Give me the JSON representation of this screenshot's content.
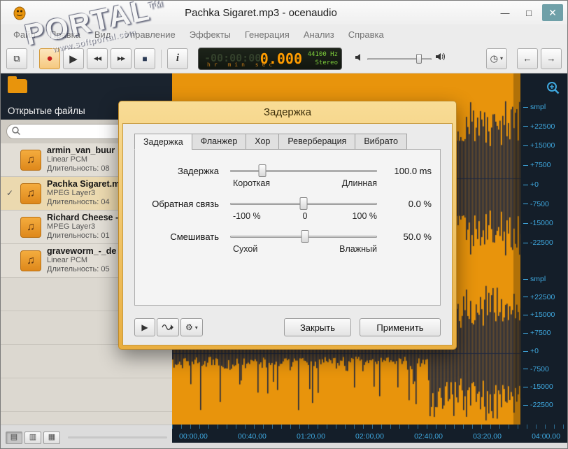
{
  "window": {
    "title": "Pachka Sigaret.mp3 - ocenaudio",
    "controls": {
      "minimize": "—",
      "maximize": "□",
      "close": "✕"
    }
  },
  "menu": {
    "items": [
      "Файл",
      "Правка",
      "Вид",
      "Управление",
      "Эффекты",
      "Генерация",
      "Анализ",
      "Справка"
    ]
  },
  "toolbar": {
    "icons": {
      "save": "⧉",
      "record": "●",
      "play": "▶",
      "rewind": "◀◀",
      "forward": "▶▶",
      "stop": "■",
      "info": "i",
      "clock": "◷",
      "back": "←",
      "next": "→",
      "dropdown": "▾"
    },
    "lcd": {
      "ghost": "-00:00:00",
      "value": "0.000",
      "rate": "44100 Hz",
      "mode": "Stereo",
      "units": "hr  min  sec"
    }
  },
  "sidebar": {
    "title": "Открытые файлы",
    "check": "✓",
    "note_icon": "♫",
    "files": [
      {
        "name": "armin_van_buur",
        "format": "Linear PCM",
        "duration": "Длительность: 08"
      },
      {
        "name": "Pachka Sigaret.m",
        "format": "MPEG Layer3",
        "duration": "Длительность: 04"
      },
      {
        "name": "Richard Cheese -",
        "format": "MPEG Layer3",
        "duration": "Длительность: 01"
      },
      {
        "name": "graveworm_-_de",
        "format": "Linear PCM",
        "duration": "Длительность: 05"
      }
    ]
  },
  "dialog": {
    "title": "Задержка",
    "tabs": [
      "Задержка",
      "Фланжер",
      "Хор",
      "Реверберация",
      "Вибрато"
    ],
    "params": [
      {
        "label": "Задержка",
        "value": "100.0 ms",
        "min": "Короткая",
        "max": "Длинная",
        "percent": 22
      },
      {
        "label": "Обратная связь",
        "value": "0.0 %",
        "min": "-100 %",
        "mid": "0",
        "max": "100 %",
        "percent": 50
      },
      {
        "label": "Смешивать",
        "value": "50.0 %",
        "min": "Сухой",
        "max": "Влажный",
        "percent": 51
      }
    ],
    "preview": {
      "play": "▶",
      "gear": "⚙",
      "dropdown": "▾"
    },
    "buttons": {
      "close": "Закрыть",
      "apply": "Применить"
    }
  },
  "ruler": {
    "labels": [
      "smpl",
      "+22500",
      "+15000",
      "+7500",
      "+0",
      "-7500",
      "-15000",
      "-22500",
      "smpl",
      "+22500",
      "+15000",
      "+7500",
      "+0",
      "-7500",
      "-15000",
      "-22500"
    ]
  },
  "timeline": {
    "labels": [
      "00:00,00",
      "00:40,00",
      "01:20,00",
      "02:00,00",
      "02:40,00",
      "03:20,00",
      "04:00,00"
    ]
  },
  "statusbar": {
    "view_buttons": [
      "▤",
      "▥",
      "▦"
    ]
  },
  "watermark": {
    "brand": "PORTAL",
    "tm": "TM",
    "url": "www.softportal.com"
  },
  "colors": {
    "wave_bg": "#E8940C",
    "wave_fg": "#20293F",
    "ruler_bg": "#141E29",
    "ruler_text": "#3FA9E0",
    "accent_orange": "#E9AE3F"
  }
}
